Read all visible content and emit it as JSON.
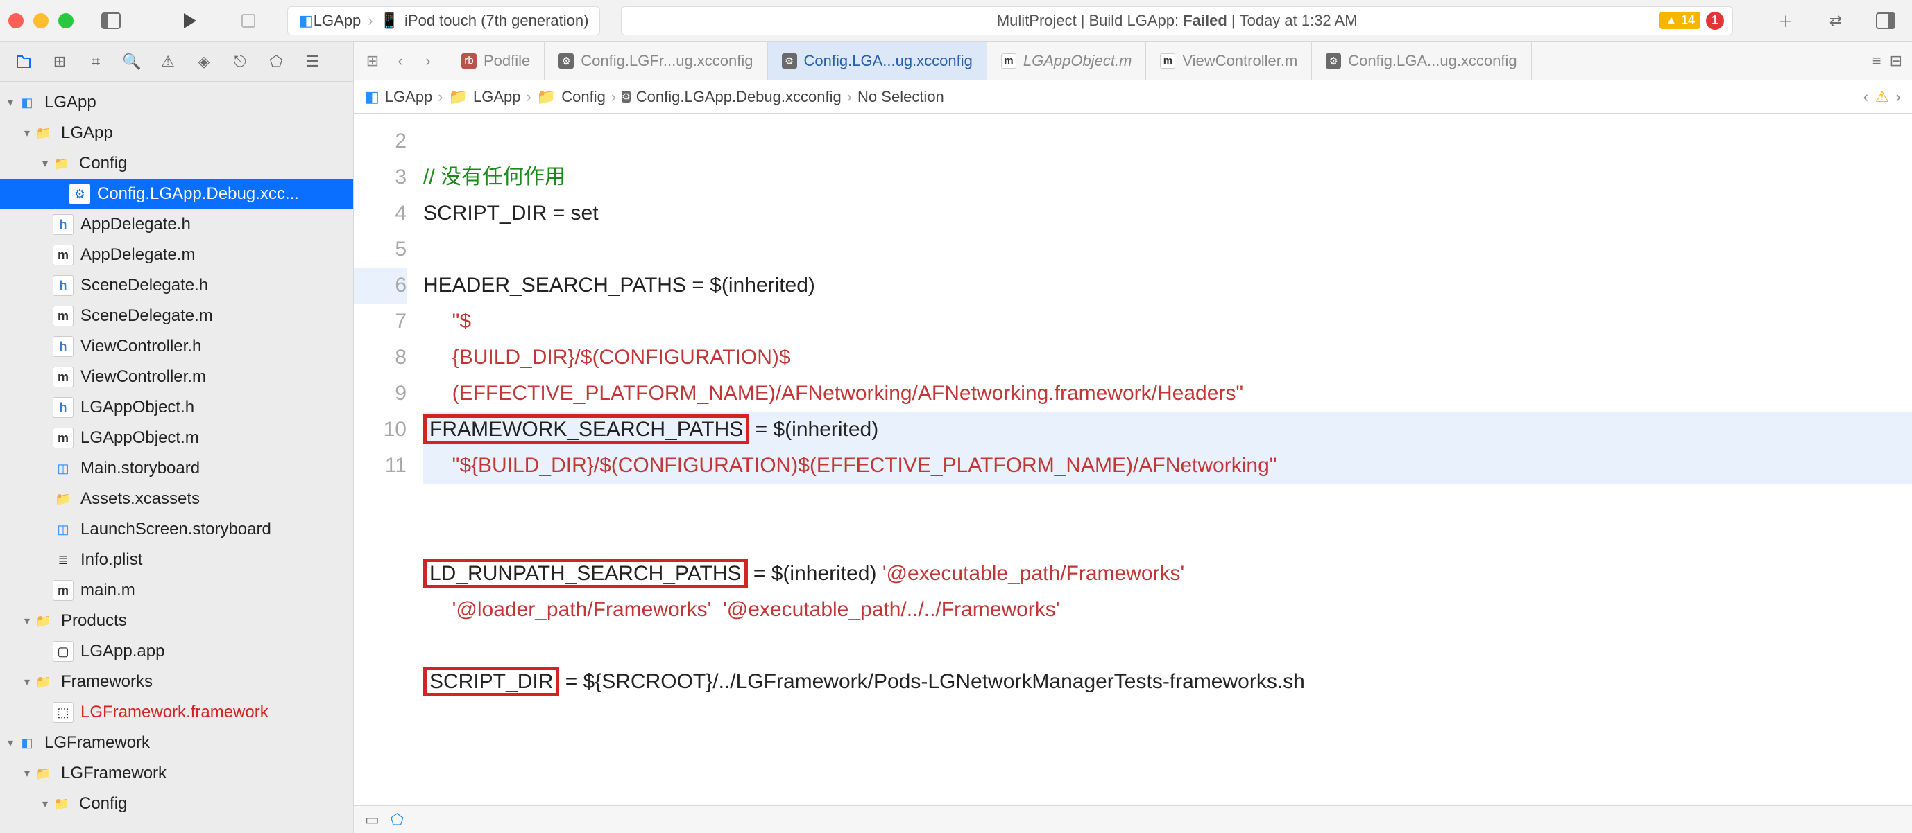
{
  "toolbar": {
    "scheme_app": "LGApp",
    "scheme_device": "iPod touch (7th generation)",
    "status_project": "MulitProject",
    "status_action": "Build LGApp:",
    "status_result": "Failed",
    "status_time": "Today at 1:32 AM",
    "warn_count": "14",
    "err_count": "1"
  },
  "sidebar": {
    "root1": "LGApp",
    "root1_app": "LGApp",
    "config": "Config",
    "cfg_file": "Config.LGApp.Debug.xcc...",
    "files": {
      "appdelegate_h": "AppDelegate.h",
      "appdelegate_m": "AppDelegate.m",
      "scenedelegate_h": "SceneDelegate.h",
      "scenedelegate_m": "SceneDelegate.m",
      "viewcontroller_h": "ViewController.h",
      "viewcontroller_m": "ViewController.m",
      "lgappobject_h": "LGAppObject.h",
      "lgappobject_m": "LGAppObject.m",
      "main_sb": "Main.storyboard",
      "assets": "Assets.xcassets",
      "launch_sb": "LaunchScreen.storyboard",
      "infoplist": "Info.plist",
      "main_m": "main.m"
    },
    "products": "Products",
    "app_product": "LGApp.app",
    "frameworks": "Frameworks",
    "lgframework_fw": "LGFramework.framework",
    "root2": "LGFramework",
    "root2_app": "LGFramework",
    "root2_config": "Config"
  },
  "tabs": {
    "podfile": "Podfile",
    "cfg_fr": "Config.LGFr...ug.xcconfig",
    "cfg_app": "Config.LGA...ug.xcconfig",
    "lgappobj": "LGAppObject.m",
    "viewctrl": "ViewController.m",
    "cfg_app2": "Config.LGA...ug.xcconfig"
  },
  "jumpbar": {
    "p0": "LGApp",
    "p1": "LGApp",
    "p2": "Config",
    "p3": "Config.LGApp.Debug.xcconfig",
    "p4": "No Selection"
  },
  "code": {
    "l2": "// 没有任何作用",
    "l3": "SCRIPT_DIR = set",
    "l4": "",
    "l5a": "HEADER_SEARCH_PATHS = $(inherited)",
    "l5b": "     \"$",
    "l5c": "     {BUILD_DIR}/$(CONFIGURATION)$",
    "l5d": "     (EFFECTIVE_PLATFORM_NAME)/AFNetworking/AFNetworking.framework/Headers\"",
    "l6_key": "FRAMEWORK_SEARCH_PATHS",
    "l6_rest": " = $(inherited)",
    "l6b": "     \"${BUILD_DIR}/$(CONFIGURATION)$(EFFECTIVE_PLATFORM_NAME)/AFNetworking\"",
    "l7": "",
    "l8_key": "LD_RUNPATH_SEARCH_PATHS",
    "l8_rest": " = $(inherited) ",
    "l8_red1": "'@executable_path/Frameworks'",
    "l8b_red": "     '@loader_path/Frameworks'  '@executable_path/../../Frameworks'",
    "l9": "",
    "l10_key": "SCRIPT_DIR",
    "l10_rest": " = ${SRCROOT}/../LGFramework/Pods-LGNetworkManagerTests-frameworks.sh",
    "l11": ""
  },
  "gutter": [
    "2",
    "3",
    "4",
    "5",
    "",
    "",
    "",
    "6",
    "",
    "7",
    "8",
    "",
    "9",
    "10",
    "11"
  ]
}
